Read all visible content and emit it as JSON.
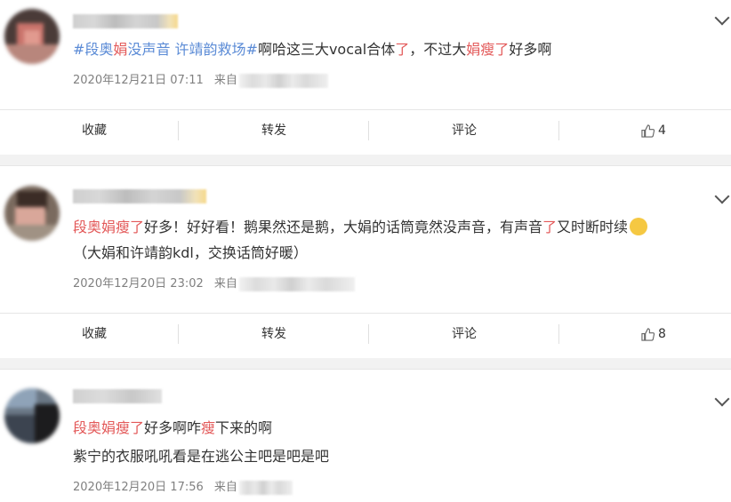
{
  "actions": {
    "collect": "收藏",
    "repost": "转发",
    "comment": "评论"
  },
  "posts": [
    {
      "line1": [
        {
          "t": "#段奥",
          "c": "tag"
        },
        {
          "t": "娟",
          "c": "hl"
        },
        {
          "t": "没声音 许靖韵救场#",
          "c": "tag"
        },
        {
          "t": "啊哈这三大vocal合体",
          "c": ""
        },
        {
          "t": "了",
          "c": "hl"
        },
        {
          "t": "，不过大",
          "c": ""
        },
        {
          "t": "娟",
          "c": "hl"
        },
        {
          "t": "瘦了",
          "c": "hl"
        },
        {
          "t": "好多啊",
          "c": ""
        }
      ],
      "time": "2020年12月21日 07:11",
      "source_prefix": "来自",
      "likes": "4"
    },
    {
      "line1": [
        {
          "t": "段奥娟瘦了",
          "c": "hl"
        },
        {
          "t": "好多！好好看！鹅果然还是鹅，大娟的话筒竟然没声音，有声音",
          "c": ""
        },
        {
          "t": "了",
          "c": "hl"
        },
        {
          "t": "又时断时续",
          "c": ""
        }
      ],
      "line2": "（大娟和许靖韵kdl，交换话筒好暖）",
      "emoji": "smirk-emoji",
      "time": "2020年12月20日 23:02",
      "source_prefix": "来自",
      "likes": "8"
    },
    {
      "line1": [
        {
          "t": "段奥娟瘦了",
          "c": "hl"
        },
        {
          "t": "好多啊咋",
          "c": ""
        },
        {
          "t": "瘦",
          "c": "hl"
        },
        {
          "t": "下来的啊",
          "c": ""
        }
      ],
      "line2": "紫宁的衣服吼吼看是在逃公主吧是吧是吧",
      "time": "2020年12月20日 17:56",
      "source_prefix": "来自"
    }
  ]
}
